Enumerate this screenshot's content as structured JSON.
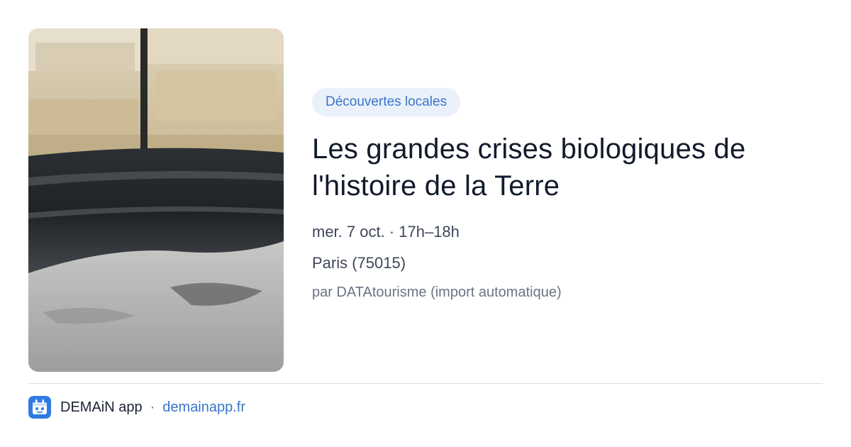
{
  "card": {
    "image": {
      "subject": "rock-strata-photo"
    },
    "category_label": "Découvertes locales",
    "title": "Les grandes crises biologiques de l'histoire de la Terre",
    "date_time": "mer. 7 oct. · 17h–18h",
    "location": "Paris (75015)",
    "source": "par DATAtourisme (import automatique)"
  },
  "footer": {
    "app_icon": "app-logo-icon",
    "app_name": "DEMAiN app",
    "separator": "·",
    "app_link": "demainapp.fr"
  },
  "colors": {
    "accent": "#3a74c9",
    "tag_bg": "#eaf1fb",
    "title": "#121a2b",
    "muted": "#6b7384",
    "divider": "#d9dee6"
  }
}
